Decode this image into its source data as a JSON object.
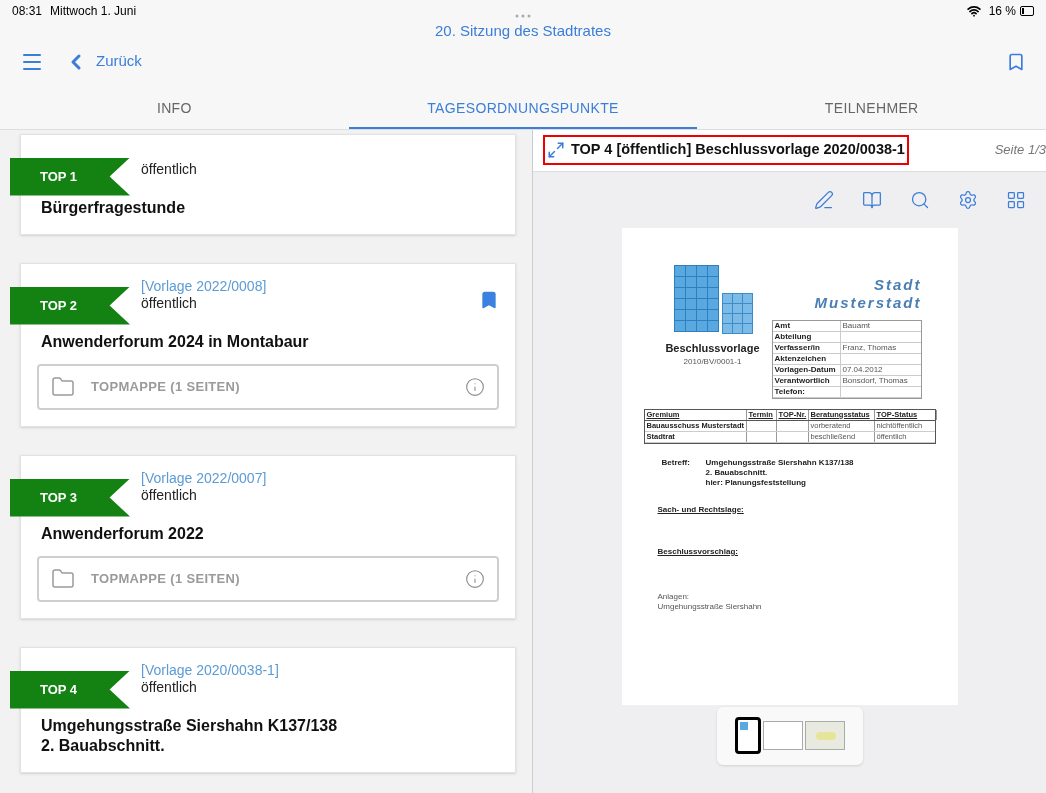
{
  "status_bar": {
    "time": "08:31",
    "date": "Mittwoch 1. Juni",
    "battery": "16 %"
  },
  "title": "20. Sitzung des Stadtrates",
  "nav": {
    "back": "Zurück"
  },
  "tabs": [
    {
      "label": "INFO",
      "selected": false
    },
    {
      "label": "TAGESORDNUNGSPUNKTE",
      "selected": true
    },
    {
      "label": "TEILNEHMER",
      "selected": false
    }
  ],
  "agenda": [
    {
      "number": "TOP 1",
      "status": "öffentlich",
      "title": [
        "Bürgerfragestunde"
      ],
      "bookmarked": false
    },
    {
      "number": "TOP 2",
      "vorlage": "[Vorlage 2022/0008]",
      "status": "öffentlich",
      "title": [
        "Anwenderforum 2024 in Montabaur"
      ],
      "bookmarked": true,
      "folder": "TOPMAPPE (1 SEITEN)"
    },
    {
      "number": "TOP 3",
      "vorlage": "[Vorlage 2022/0007]",
      "status": "öffentlich",
      "title": [
        "Anwenderforum 2022"
      ],
      "bookmarked": false,
      "folder": "TOPMAPPE (1 SEITEN)"
    },
    {
      "number": "TOP 4",
      "vorlage": "[Vorlage 2020/0038-1]",
      "status": "öffentlich",
      "title": [
        "Umgehungsstraße Siershahn K137/138",
        "2. Bauabschnitt."
      ],
      "bookmarked": false
    }
  ],
  "viewer": {
    "title": "TOP 4 [öffentlich] Beschlussvorlage 2020/0038-1",
    "page": "Seite 1/3",
    "document": {
      "city": [
        "Stadt",
        "Musterstadt"
      ],
      "doc_type": "Beschlussvorlage",
      "doc_number": "2010/BV/0001-1",
      "meta": [
        {
          "label": "Amt",
          "value": "Bauamt"
        },
        {
          "label": "Abteilung"
        },
        {
          "label": "Verfasser/in",
          "value": "Franz, Thomas"
        },
        {
          "label": "Aktenzeichen"
        },
        {
          "label": "Vorlagen-Datum",
          "value": "07.04.2012"
        },
        {
          "label": "Verantwortlich",
          "value": "Bonsdorf, Thomas"
        },
        {
          "label": "Telefon:"
        }
      ],
      "columns": [
        "Gremium",
        "Termin",
        "TOP-Nr.",
        "Beratungsstatus",
        "TOP-Status"
      ],
      "rows": [
        {
          "gremium": "Bauausschuss Musterstadt",
          "beratungsstatus": "vorberatend",
          "top_status": "nichtöffentlich"
        },
        {
          "gremium": "Stadtrat",
          "beratungsstatus": "beschließend",
          "top_status": "öffentlich"
        }
      ],
      "subject_label": "Betreff:",
      "subject": [
        "Umgehungsstraße Siershahn K137/138",
        "2. Bauabschnitt.",
        "hier: Planungsfeststellung"
      ],
      "sections": [
        "Sach- und Rechtslage:",
        "Beschlussvorschlag:"
      ],
      "attachments_label": "Anlagen:",
      "attachments": [
        "Umgehungsstraße Siershahn"
      ]
    },
    "thumbnails": [
      {
        "kind": "document",
        "selected": true
      },
      {
        "kind": "blank",
        "selected": false
      },
      {
        "kind": "map",
        "selected": false
      }
    ]
  }
}
